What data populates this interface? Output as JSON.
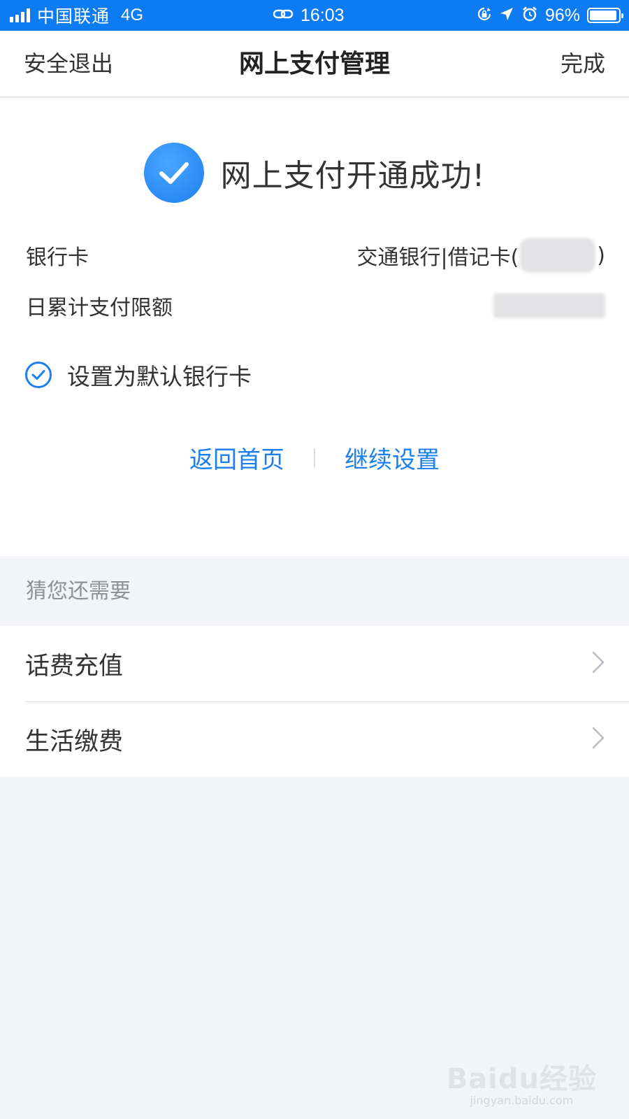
{
  "status_bar": {
    "carrier": "中国联通",
    "network": "4G",
    "time": "16:03",
    "battery": "96%",
    "battery_level": 0.96,
    "icons": [
      "signal-icon",
      "link-icon",
      "rotation-lock-icon",
      "location-icon",
      "alarm-icon",
      "battery-icon"
    ]
  },
  "nav": {
    "left": "安全退出",
    "title": "网上支付管理",
    "right": "完成"
  },
  "success": {
    "message": "网上支付开通成功!"
  },
  "card_info": {
    "bank_label": "银行卡",
    "bank_value_prefix": "交通银行|借记卡(",
    "bank_value_suffix": ")",
    "limit_label": "日累计支付限额"
  },
  "default_card": {
    "label": "设置为默认银行卡",
    "checked": true
  },
  "links": {
    "home": "返回首页",
    "continue": "继续设置"
  },
  "suggestions": {
    "header": "猜您还需要",
    "items": [
      {
        "label": "话费充值"
      },
      {
        "label": "生活缴费"
      }
    ]
  },
  "watermark": {
    "logo": "Baidu经验",
    "url": "jingyan.baidu.com"
  },
  "colors": {
    "status_bar": "#0d7cf2",
    "accent": "#1b7ff0",
    "background": "#f2f4f7"
  }
}
